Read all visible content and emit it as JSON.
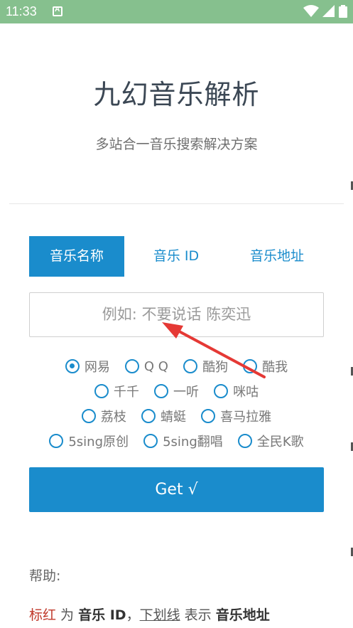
{
  "status_bar": {
    "time": "11:33",
    "icons": [
      "notification-a-icon",
      "wifi-icon",
      "signal-icon",
      "battery-icon"
    ],
    "bg_color": "#86c08e"
  },
  "header": {
    "title": "九幻音乐解析",
    "subtitle": "多站合一音乐搜索解决方案"
  },
  "tabs": [
    {
      "label": "音乐名称",
      "active": true
    },
    {
      "label": "音乐 ID",
      "active": false
    },
    {
      "label": "音乐地址",
      "active": false
    }
  ],
  "search": {
    "placeholder": "例如: 不要说话 陈奕迅",
    "value": ""
  },
  "sources": {
    "selected": "网易",
    "rows": [
      [
        "网易",
        "Q Q",
        "酷狗",
        "酷我"
      ],
      [
        "千千",
        "一听",
        "咪咕"
      ],
      [
        "荔枝",
        "蜻蜓",
        "喜马拉雅"
      ],
      [
        "5sing原创",
        "5sing翻唱",
        "全民K歌"
      ]
    ]
  },
  "get_button": {
    "label": "Get √"
  },
  "help": {
    "title": "帮助:",
    "line_parts": {
      "red_text": "标红",
      "t1": " 为 ",
      "bold1": "音乐 ID",
      "t2": "，",
      "underline_text": "下划线",
      "t3": " 表示 ",
      "bold2": "音乐地址"
    }
  },
  "colors": {
    "accent": "#1a8ccc",
    "arrow": "#e53935"
  }
}
